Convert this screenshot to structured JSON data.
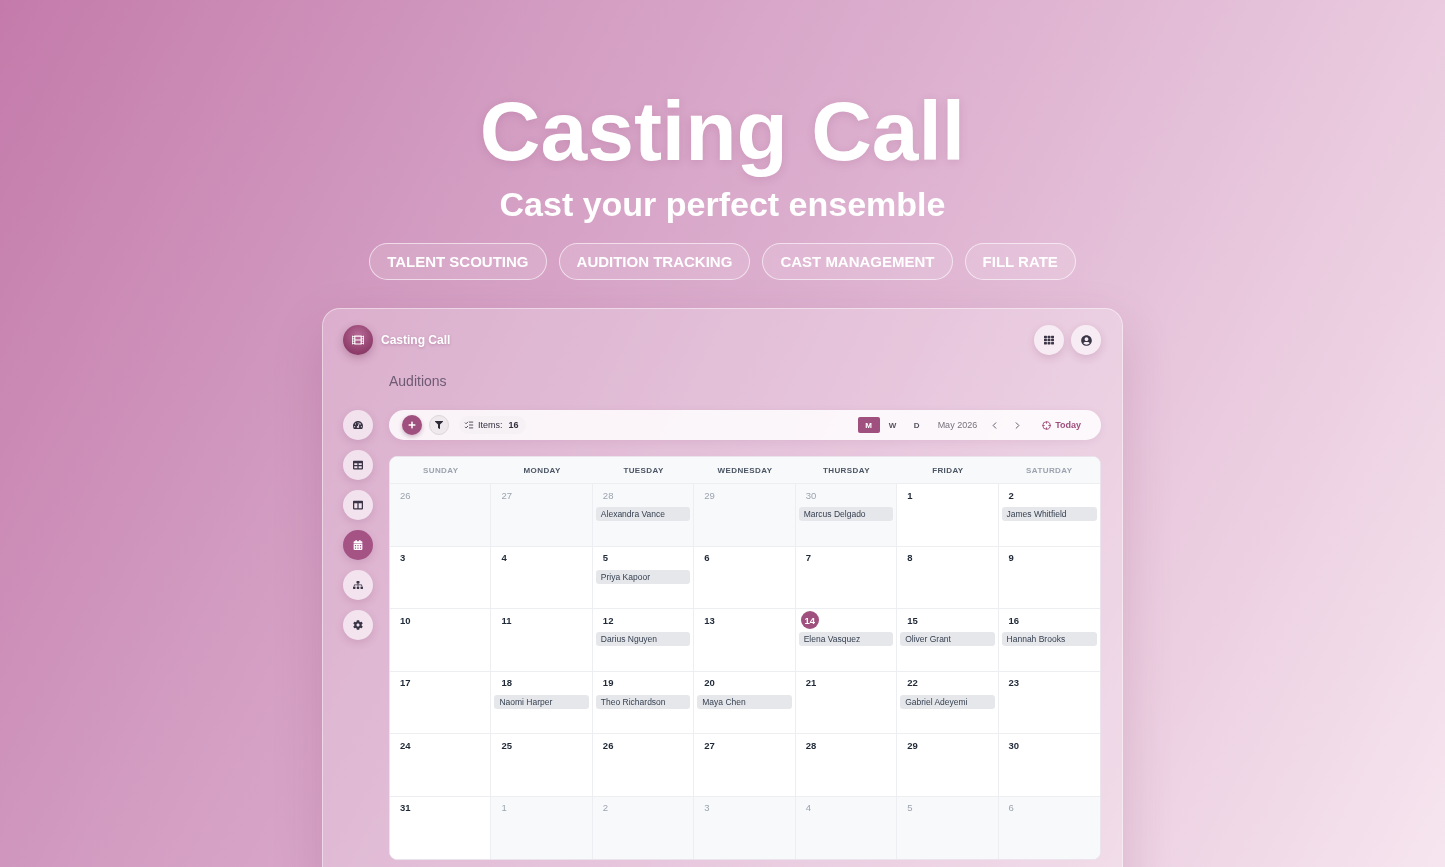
{
  "hero": {
    "title": "Casting Call",
    "subtitle": "Cast your perfect ensemble",
    "tags": [
      "TALENT SCOUTING",
      "AUDITION TRACKING",
      "CAST MANAGEMENT",
      "FILL RATE"
    ]
  },
  "app": {
    "brand": "Casting Call",
    "page_title": "Auditions"
  },
  "sidebar": {
    "items": [
      {
        "selected": false
      },
      {
        "selected": false
      },
      {
        "selected": false
      },
      {
        "selected": true
      },
      {
        "selected": false
      },
      {
        "selected": false
      }
    ]
  },
  "toolbar": {
    "items_label": "Items:",
    "items_count": "16",
    "views": [
      {
        "label": "M",
        "selected": true
      },
      {
        "label": "W",
        "selected": false
      },
      {
        "label": "D",
        "selected": false
      }
    ],
    "period": "May 2026",
    "today_label": "Today"
  },
  "calendar": {
    "columns": [
      {
        "label": "SUNDAY",
        "weekend": true
      },
      {
        "label": "MONDAY",
        "weekend": false
      },
      {
        "label": "TUESDAY",
        "weekend": false
      },
      {
        "label": "WEDNESDAY",
        "weekend": false
      },
      {
        "label": "THURSDAY",
        "weekend": false
      },
      {
        "label": "FRIDAY",
        "weekend": false
      },
      {
        "label": "SATURDAY",
        "weekend": true
      }
    ],
    "weeks": [
      {
        "days": [
          {
            "day": "26",
            "in_month": false,
            "today": false
          },
          {
            "day": "27",
            "in_month": false,
            "today": false
          },
          {
            "day": "28",
            "in_month": false,
            "today": false,
            "events": [
              "Alexandra Vance"
            ]
          },
          {
            "day": "29",
            "in_month": false,
            "today": false
          },
          {
            "day": "30",
            "in_month": false,
            "today": false,
            "events": [
              "Marcus Delgado"
            ]
          },
          {
            "day": "1",
            "in_month": true,
            "today": false
          },
          {
            "day": "2",
            "in_month": true,
            "today": false,
            "events": [
              "James Whitfield"
            ]
          }
        ]
      },
      {
        "days": [
          {
            "day": "3",
            "in_month": true,
            "today": false
          },
          {
            "day": "4",
            "in_month": true,
            "today": false
          },
          {
            "day": "5",
            "in_month": true,
            "today": false,
            "events": [
              "Priya Kapoor"
            ]
          },
          {
            "day": "6",
            "in_month": true,
            "today": false
          },
          {
            "day": "7",
            "in_month": true,
            "today": false
          },
          {
            "day": "8",
            "in_month": true,
            "today": false
          },
          {
            "day": "9",
            "in_month": true,
            "today": false
          }
        ]
      },
      {
        "days": [
          {
            "day": "10",
            "in_month": true,
            "today": false
          },
          {
            "day": "11",
            "in_month": true,
            "today": false
          },
          {
            "day": "12",
            "in_month": true,
            "today": false,
            "events": [
              "Darius Nguyen"
            ]
          },
          {
            "day": "13",
            "in_month": true,
            "today": false
          },
          {
            "day": "14",
            "in_month": true,
            "today": true,
            "events": [
              "Elena Vasquez"
            ]
          },
          {
            "day": "15",
            "in_month": true,
            "today": false,
            "events": [
              "Oliver Grant"
            ]
          },
          {
            "day": "16",
            "in_month": true,
            "today": false,
            "events": [
              "Hannah Brooks"
            ]
          }
        ]
      },
      {
        "days": [
          {
            "day": "17",
            "in_month": true,
            "today": false
          },
          {
            "day": "18",
            "in_month": true,
            "today": false,
            "events": [
              "Naomi Harper"
            ]
          },
          {
            "day": "19",
            "in_month": true,
            "today": false,
            "events": [
              "Theo Richardson"
            ]
          },
          {
            "day": "20",
            "in_month": true,
            "today": false,
            "events": [
              "Maya Chen"
            ]
          },
          {
            "day": "21",
            "in_month": true,
            "today": false
          },
          {
            "day": "22",
            "in_month": true,
            "today": false,
            "events": [
              "Gabriel Adeyemi"
            ]
          },
          {
            "day": "23",
            "in_month": true,
            "today": false
          }
        ]
      },
      {
        "days": [
          {
            "day": "24",
            "in_month": true,
            "today": false
          },
          {
            "day": "25",
            "in_month": true,
            "today": false
          },
          {
            "day": "26",
            "in_month": true,
            "today": false
          },
          {
            "day": "27",
            "in_month": true,
            "today": false
          },
          {
            "day": "28",
            "in_month": true,
            "today": false
          },
          {
            "day": "29",
            "in_month": true,
            "today": false
          },
          {
            "day": "30",
            "in_month": true,
            "today": false
          }
        ]
      },
      {
        "days": [
          {
            "day": "31",
            "in_month": true,
            "today": false
          },
          {
            "day": "1",
            "in_month": false,
            "today": false
          },
          {
            "day": "2",
            "in_month": false,
            "today": false
          },
          {
            "day": "3",
            "in_month": false,
            "today": false
          },
          {
            "day": "4",
            "in_month": false,
            "today": false
          },
          {
            "day": "5",
            "in_month": false,
            "today": false
          },
          {
            "day": "6",
            "in_month": false,
            "today": false
          }
        ]
      }
    ]
  }
}
